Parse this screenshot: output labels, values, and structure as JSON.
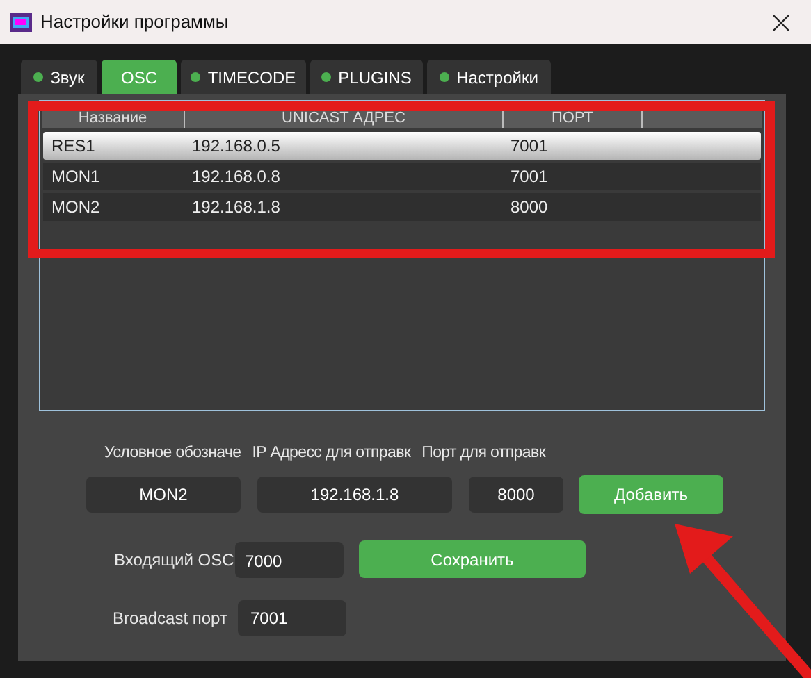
{
  "window": {
    "title": "Настройки программы"
  },
  "tabs": [
    {
      "label": "Звук",
      "selected": false
    },
    {
      "label": "OSC",
      "selected": true
    },
    {
      "label": "TIMECODE",
      "selected": false
    },
    {
      "label": "PLUGINS",
      "selected": false
    },
    {
      "label": "Настройки",
      "selected": false
    }
  ],
  "table": {
    "columns": [
      "Название",
      "UNICAST АДРЕС",
      "ПОРТ"
    ],
    "rows": [
      {
        "cells": [
          "RES1",
          "192.168.0.5",
          "7001"
        ],
        "selected": true
      },
      {
        "cells": [
          "MON1",
          "192.168.0.8",
          "7001"
        ],
        "selected": false
      },
      {
        "cells": [
          "MON2",
          "192.168.1.8",
          "8000"
        ],
        "selected": false
      }
    ]
  },
  "form": {
    "labels": [
      "Условное обозначе",
      "IP Адресс для отправк",
      "Порт для отправк"
    ],
    "values": [
      "MON2",
      "192.168.1.8",
      "8000"
    ],
    "add_button": "Добавить",
    "incoming_osc": {
      "label": "Входящий OSC",
      "value": "7000"
    },
    "save_button": "Сохранить",
    "broadcast_port": {
      "label": "Broadcast порт",
      "value": "7001"
    }
  }
}
